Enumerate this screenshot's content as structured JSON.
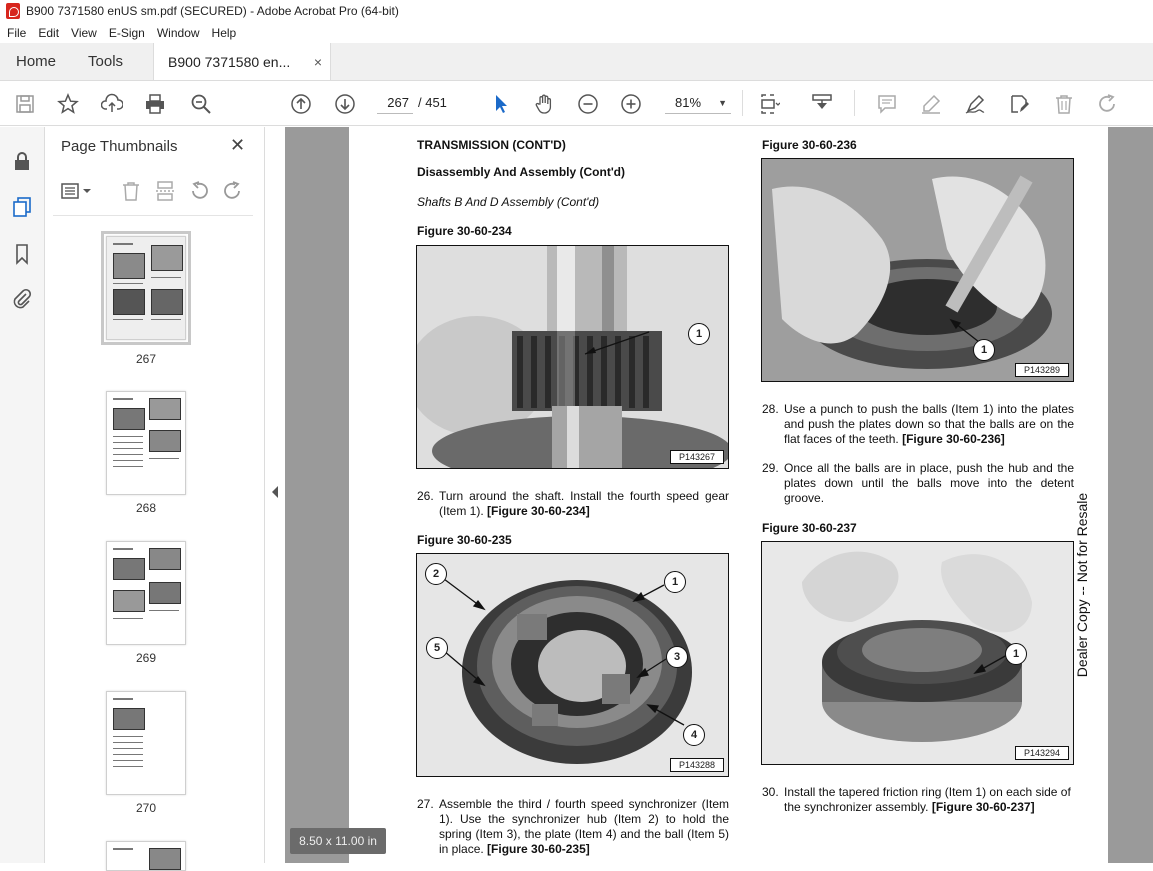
{
  "window": {
    "title": "B900 7371580 enUS sm.pdf (SECURED) - Adobe Acrobat Pro (64-bit)"
  },
  "menu": [
    "File",
    "Edit",
    "View",
    "E-Sign",
    "Window",
    "Help"
  ],
  "tabs": {
    "home": "Home",
    "tools": "Tools",
    "document": "B900 7371580 en...",
    "close": "×"
  },
  "toolbar": {
    "current_page": "267",
    "total_pages": "/ 451",
    "zoom": "81%",
    "icons": [
      "save-icon",
      "bookmark-star-icon",
      "upload-icon",
      "print-icon",
      "zoom-search-icon",
      "page-up-icon",
      "page-down-icon",
      "select-pointer-icon",
      "hand-icon",
      "zoom-out-icon",
      "zoom-in-icon",
      "fit-page-icon",
      "scroll-mode-icon",
      "comment-icon",
      "highlight-icon",
      "sign-icon",
      "edit-icon",
      "delete-icon",
      "redo-icon"
    ]
  },
  "panel": {
    "title": "Page Thumbnails",
    "close": "✕",
    "thumbnails": [
      {
        "label": "267"
      },
      {
        "label": "268"
      },
      {
        "label": "269"
      },
      {
        "label": "270"
      }
    ]
  },
  "viewer": {
    "page_size": "8.50 x 11.00 in"
  },
  "doc": {
    "heading1": "TRANSMISSION (CONT'D)",
    "heading2": "Disassembly And Assembly (Cont'd)",
    "heading3": "Shafts B And D Assembly (Cont'd)",
    "fig234": {
      "title": "Figure 30-60-234",
      "code": "P143267",
      "callouts": [
        "1"
      ]
    },
    "step26": {
      "num": "26.",
      "text": "Turn around the shaft. Install the fourth speed gear (Item 1).",
      "ref": "[Figure 30-60-234]"
    },
    "fig235": {
      "title": "Figure 30-60-235",
      "code": "P143288",
      "callouts": [
        "2",
        "1",
        "5",
        "3",
        "4"
      ]
    },
    "step27": {
      "num": "27.",
      "text": "Assemble the third / fourth speed synchronizer (Item 1). Use the synchronizer hub (Item 2) to hold the spring (Item 3), the plate (Item 4) and the ball (Item 5) in place.",
      "ref": "[Figure 30-60-235]"
    },
    "fig236": {
      "title": "Figure 30-60-236",
      "code": "P143289",
      "callouts": [
        "1"
      ]
    },
    "step28": {
      "num": "28.",
      "text": "Use a punch to push the balls (Item 1) into the plates and push the plates down so that the balls are on the flat faces of the teeth.",
      "ref": "[Figure 30-60-236]"
    },
    "step29": {
      "num": "29.",
      "text": "Once all the balls are in place, push the hub and the plates down until the balls move into the detent groove."
    },
    "fig237": {
      "title": "Figure 30-60-237",
      "code": "P143294",
      "callouts": [
        "1"
      ]
    },
    "step30": {
      "num": "30.",
      "text": "Install the tapered friction ring (Item 1) on each side of the synchronizer assembly.",
      "ref": "[Figure 30-60-237]"
    },
    "watermark": "Dealer Copy -- Not for Resale"
  }
}
